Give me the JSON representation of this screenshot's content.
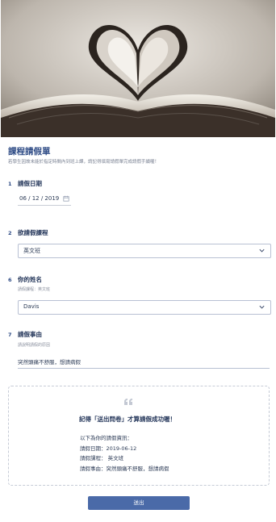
{
  "form": {
    "title": "課程請假單",
    "description": "若學生因故未能於指定時間內到班上課，請記得填寫請假單完成請假手續喔！"
  },
  "questions": [
    {
      "number": "1",
      "label": "請假日期",
      "value": "06 / 12 / 2019"
    },
    {
      "number": "2",
      "label": "欲請假課程",
      "value": "英文班"
    },
    {
      "number": "6",
      "label": "你的姓名",
      "sub": "請假課程：英文班",
      "value": "Davis"
    },
    {
      "number": "7",
      "label": "請假事由",
      "sub": "請說明請假的原因",
      "value": "突然頭痛不舒服，想請病假"
    }
  ],
  "result": {
    "title": "記得「送出問卷」才算請假成功喔！",
    "lines": [
      "以下為你的請假資訊：",
      "請假日期：2019-06-12",
      "請假課程： 英文班",
      "請假事由：突然頭痛不舒服，想請病假"
    ]
  },
  "submit_label": "送出",
  "colors": {
    "accent": "#4a6aa8",
    "title": "#2f4c86"
  },
  "icons": {
    "date": "calendar-icon",
    "select": "chevron-down-icon",
    "quote": "quote-icon"
  }
}
